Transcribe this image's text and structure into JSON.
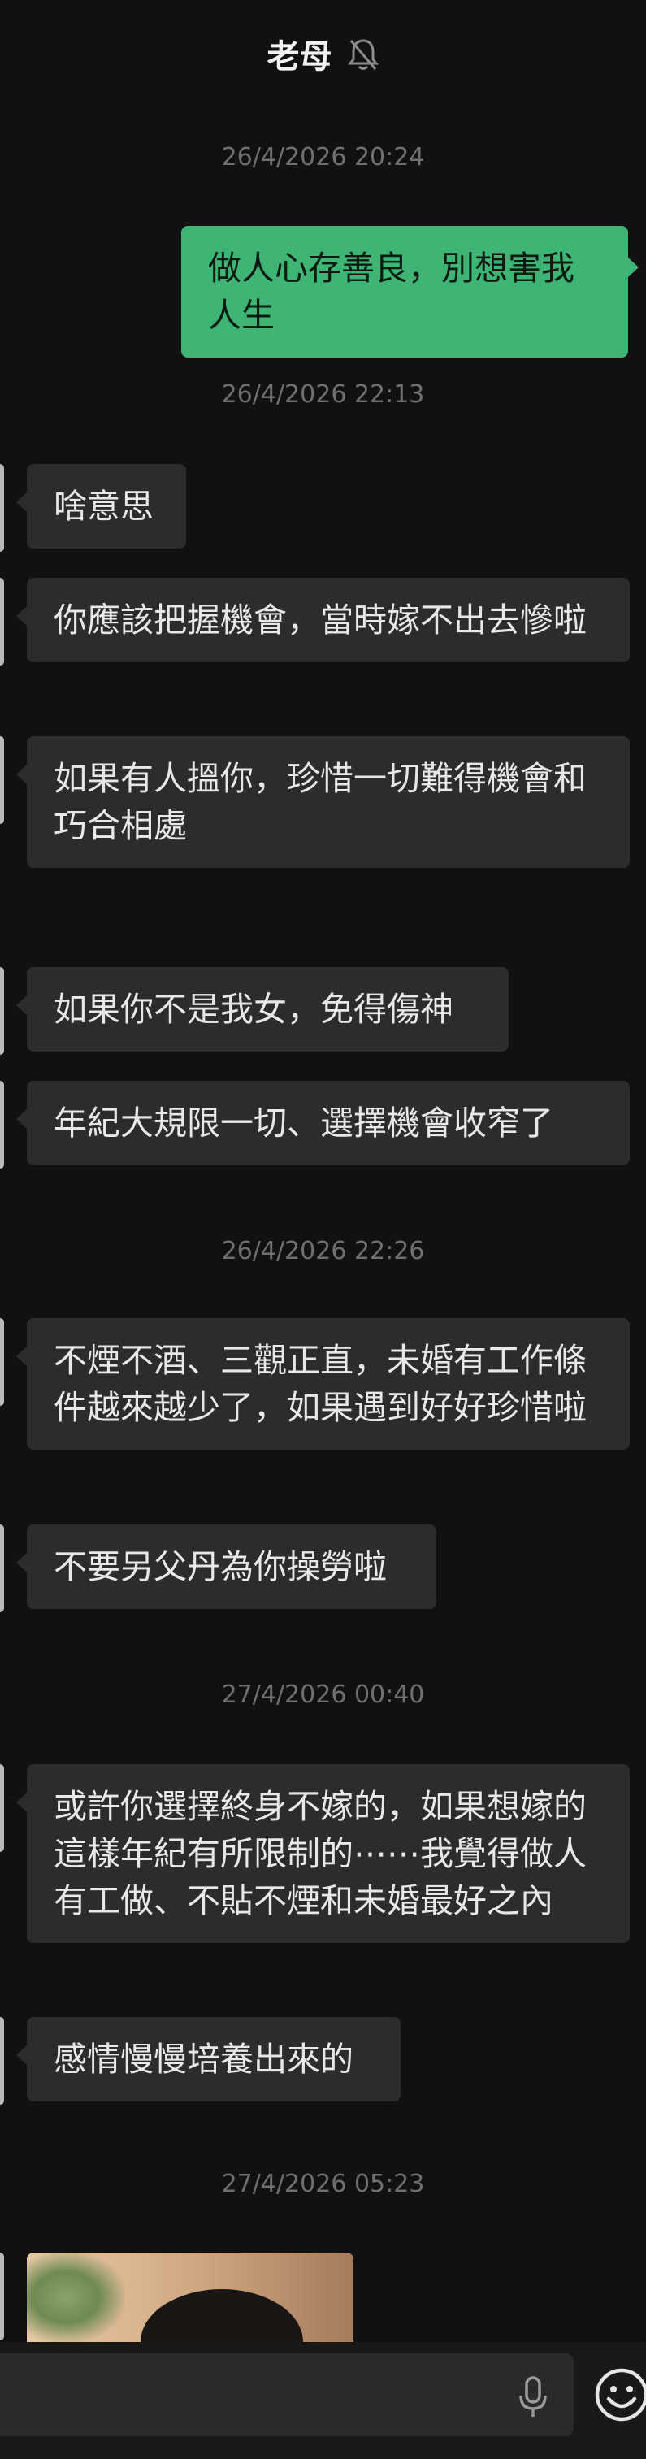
{
  "header": {
    "title": "老母",
    "mute_icon": "bell-muted-icon"
  },
  "timestamps": [
    "26/4/2026 20:24",
    "26/4/2026 22:13",
    "26/4/2026 22:26",
    "27/4/2026 00:40",
    "27/4/2026 05:23"
  ],
  "messages": [
    {
      "side": "out",
      "text": "做人心存善良，別想害我人生"
    },
    {
      "side": "in",
      "text": "啥意思"
    },
    {
      "side": "in",
      "text": "你應該把握機會，當時嫁不出去慘啦"
    },
    {
      "side": "in",
      "text": "如果有人搵你，珍惜一切難得機會和巧合相處"
    },
    {
      "side": "in",
      "text": "如果你不是我女，免得傷神"
    },
    {
      "side": "in",
      "text": "年紀大規限一切、選擇機會收窄了"
    },
    {
      "side": "in",
      "text": "不煙不酒、三觀正直，未婚有工作條件越來越少了，如果遇到好好珍惜啦"
    },
    {
      "side": "in",
      "text": "不要另父丹為你操勞啦"
    },
    {
      "side": "in",
      "text": "或許你選擇終身不嫁的，如果想嫁的這樣年紀有所限制的⋯⋯我覺得做人有工做、不貼不煙和未婚最好之內"
    },
    {
      "side": "in",
      "text": "感情慢慢培養出來的"
    }
  ],
  "composer": {
    "value": "",
    "mic_icon": "microphone-icon",
    "emoji_icon": "emoji-icon"
  },
  "colors": {
    "background": "#111111",
    "incoming_bubble": "#2c2c2c",
    "outgoing_bubble": "#3eb575",
    "timestamp": "#6f6f6f"
  }
}
